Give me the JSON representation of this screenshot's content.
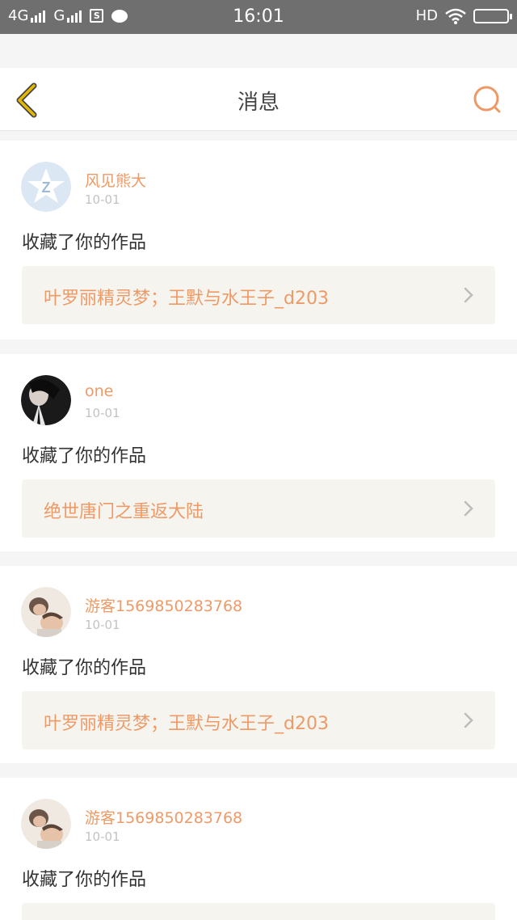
{
  "status_bar": {
    "network1": "4G",
    "network2": "G",
    "time": "16:01",
    "hd": "HD"
  },
  "header": {
    "title": "消息"
  },
  "colors": {
    "accent": "#ee9a67",
    "back_icon": "#e6b800",
    "status_bar": "#6f6f6f"
  },
  "messages": [
    {
      "user": "风见熊大",
      "date": "10-01",
      "action": "收藏了你的作品",
      "work": "叶罗丽精灵梦；王默与水王子_d203",
      "avatar": "qq-default-avatar"
    },
    {
      "user": "one",
      "date": "10-01",
      "action": "收藏了你的作品",
      "work": "绝世唐门之重返大陆",
      "avatar": "dark-portrait-avatar"
    },
    {
      "user": "游客1569850283768",
      "date": "10-01",
      "action": "收藏了你的作品",
      "work": "叶罗丽精灵梦；王默与水王子_d203",
      "avatar": "child-photo-avatar"
    },
    {
      "user": "游客1569850283768",
      "date": "10-01",
      "action": "收藏了你的作品",
      "work": "",
      "avatar": "child-photo-avatar"
    }
  ]
}
